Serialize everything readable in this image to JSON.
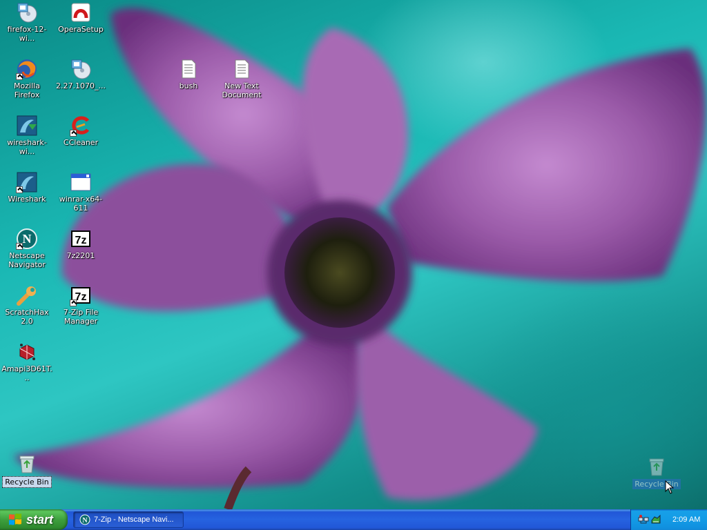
{
  "desktop": {
    "icons": [
      {
        "label": "firefox-12-wi...",
        "icon": "installer-cd-icon"
      },
      {
        "label": "OperaSetup",
        "icon": "opera-setup-icon"
      },
      {
        "label": "Mozilla Firefox",
        "icon": "firefox-icon"
      },
      {
        "label": "2.27.1070_...",
        "icon": "installer-cd-icon"
      },
      {
        "label": "bush",
        "icon": "text-document-icon"
      },
      {
        "label": "New Text Document",
        "icon": "text-document-icon"
      },
      {
        "label": "wireshark-wi...",
        "icon": "wireshark-installer-icon"
      },
      {
        "label": "CCleaner",
        "icon": "ccleaner-icon"
      },
      {
        "label": "Wireshark",
        "icon": "wireshark-icon"
      },
      {
        "label": "winrar-x64-611",
        "icon": "window-icon"
      },
      {
        "label": "Netscape Navigator",
        "icon": "netscape-icon"
      },
      {
        "label": "7z2201",
        "icon": "7zip-icon"
      },
      {
        "label": "ScratchHax 2.0",
        "icon": "wrench-icon"
      },
      {
        "label": "7-Zip File Manager",
        "icon": "7zip-icon"
      },
      {
        "label": "Amapi3D61T...",
        "icon": "amapi-icon"
      },
      {
        "label": "Recycle Bin",
        "icon": "recycle-bin-icon"
      },
      {
        "label": "Recycle Bin",
        "icon": "recycle-bin-icon"
      }
    ]
  },
  "taskbar": {
    "start_label": "start",
    "tasks": [
      {
        "label": "7-Zip - Netscape Navi...",
        "icon": "netscape-icon"
      }
    ],
    "tray": {
      "icons": [
        "network-icon",
        "security-icon"
      ],
      "clock": "2:09 AM"
    }
  },
  "colors": {
    "taskbar_blue": "#2663e0",
    "start_green": "#3e9f3e",
    "tray_blue": "#139be6"
  }
}
